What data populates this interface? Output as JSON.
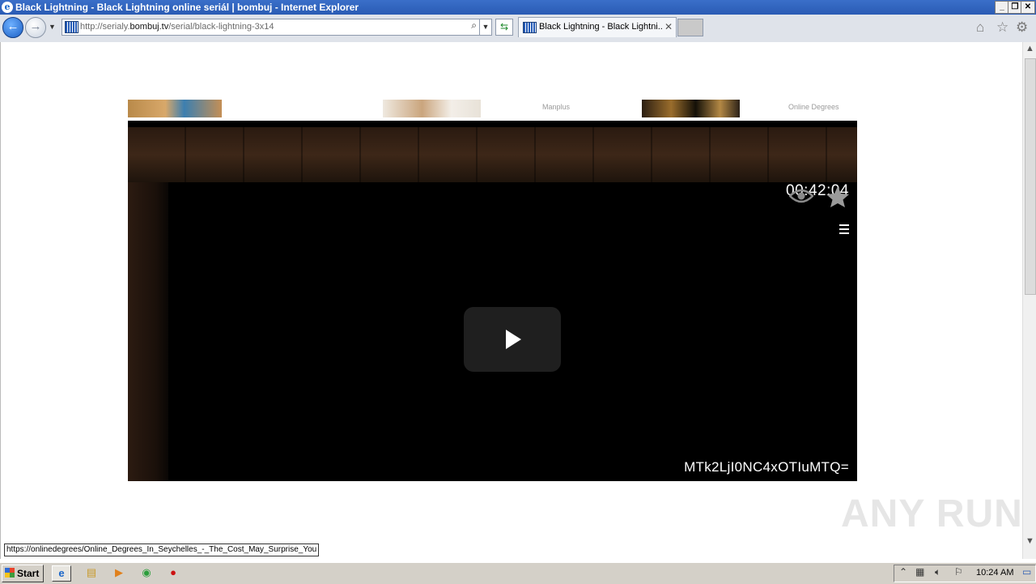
{
  "window": {
    "title": "Black Lightning - Black Lightning online seriál | bombuj - Internet Explorer",
    "buttons": {
      "minimize": "_",
      "restore": "❐",
      "close": "✕"
    }
  },
  "nav": {
    "url_prefix": "http://serialy.",
    "url_domain": "bombuj.tv",
    "url_path": "/serial/black-lightning-3x14",
    "tab_title": "Black Lightning - Black Lightni...",
    "icons": [
      "back-arrow-icon",
      "forward-arrow-icon",
      "search-icon",
      "refresh-icon",
      "home-icon",
      "favorites-star-icon",
      "gear-icon"
    ]
  },
  "ads": {
    "text_1": "Manplus",
    "text_2": "Online Degrees"
  },
  "player": {
    "timestamp": "00:42:04",
    "code": "MTk2LjI0NC4xOTIuMTQ="
  },
  "watermark": "ANY RUN",
  "status_url": "https://onlinedegrees/Online_Degrees_In_Seychelles_-_The_Cost_May_Surprise_You",
  "taskbar": {
    "start_label": "Start",
    "clock": "10:24 AM"
  }
}
